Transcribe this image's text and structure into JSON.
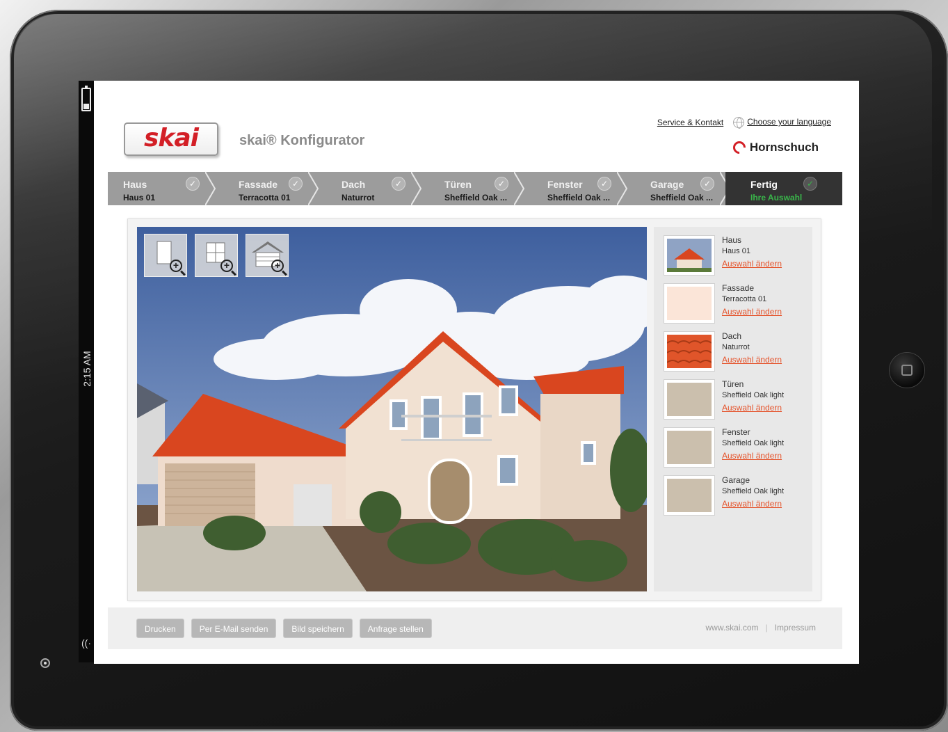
{
  "status_bar": {
    "time": "2:15 AM"
  },
  "header": {
    "logo_text": "skai",
    "app_title": "skai® Konfigurator",
    "service_link": "Service & Kontakt",
    "language_link": "Choose your language",
    "brand": "Hornschuch"
  },
  "steps": [
    {
      "title": "Haus",
      "value": "Haus 01"
    },
    {
      "title": "Fassade",
      "value": "Terracotta 01"
    },
    {
      "title": "Dach",
      "value": "Naturrot"
    },
    {
      "title": "Türen",
      "value": "Sheffield Oak ..."
    },
    {
      "title": "Fenster",
      "value": "Sheffield Oak ..."
    },
    {
      "title": "Garage",
      "value": "Sheffield Oak ..."
    },
    {
      "title": "Fertig",
      "value": "Ihre Auswahl"
    }
  ],
  "summary": [
    {
      "category": "Haus",
      "value": "Haus 01",
      "link": "Auswahl ändern",
      "swatch": "#8fa3c4"
    },
    {
      "category": "Fassade",
      "value": "Terracotta 01",
      "link": "Auswahl ändern",
      "swatch": "#fbe5d8"
    },
    {
      "category": "Dach",
      "value": "Naturrot",
      "link": "Auswahl ändern",
      "swatch": "#e0552a"
    },
    {
      "category": "Türen",
      "value": "Sheffield Oak light",
      "link": "Auswahl ändern",
      "swatch": "#cbbfad"
    },
    {
      "category": "Fenster",
      "value": "Sheffield Oak light",
      "link": "Auswahl ändern",
      "swatch": "#cbbfad"
    },
    {
      "category": "Garage",
      "value": "Sheffield Oak light",
      "link": "Auswahl ändern",
      "swatch": "#cbbfad"
    }
  ],
  "footer": {
    "buttons": [
      "Drucken",
      "Per E-Mail senden",
      "Bild speichern",
      "Anfrage stellen"
    ],
    "website": "www.skai.com",
    "impressum": "Impressum"
  },
  "colors": {
    "accent": "#e5532b",
    "brand_red": "#d31f26",
    "done_green": "#39b54a"
  }
}
